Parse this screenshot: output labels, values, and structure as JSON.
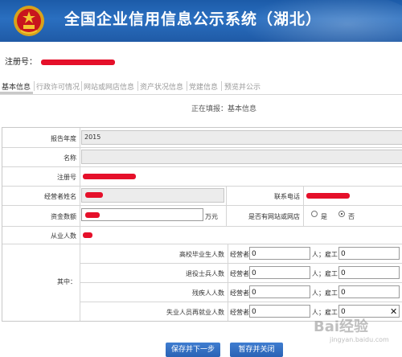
{
  "header": {
    "title": "全国企业信用信息公示系统（湖北）"
  },
  "reg": {
    "label": "注册号："
  },
  "tabs": [
    {
      "label": "基本信息",
      "active": true
    },
    {
      "label": "行政许可情况",
      "active": false
    },
    {
      "label": "网站或网店信息",
      "active": false
    },
    {
      "label": "资产状况信息",
      "active": false
    },
    {
      "label": "党建信息",
      "active": false
    },
    {
      "label": "预览并公示",
      "active": false
    }
  ],
  "status": {
    "filling": "正在填报：基本信息"
  },
  "form": {
    "report_year_label": "报告年度",
    "report_year_value": "2015",
    "name_label": "名称",
    "reg_no_label": "注册号",
    "operator_label": "经营者姓名",
    "phone_label": "联系电话",
    "capital_label": "资金数额",
    "capital_unit": "万元",
    "website_label": "是否有网站或网店",
    "website_options": [
      "是",
      "否"
    ],
    "website_selected": "否",
    "employees_label": "从业人数",
    "among_label": "其中：",
    "sub_rows": [
      {
        "label": "高校毕业生人数",
        "operator_label": "经营者",
        "operator_value": "0",
        "employee_label": "人；雇工",
        "employee_value": "0"
      },
      {
        "label": "退役士兵人数",
        "operator_label": "经营者",
        "operator_value": "0",
        "employee_label": "人；雇工",
        "employee_value": "0"
      },
      {
        "label": "残疾人人数",
        "operator_label": "经营者",
        "operator_value": "0",
        "employee_label": "人；雇工",
        "employee_value": "0"
      },
      {
        "label": "失业人员再就业人数",
        "operator_label": "经营者",
        "operator_value": "0",
        "employee_label": "人；雇工",
        "employee_value": "0"
      }
    ]
  },
  "buttons": {
    "save_next": "保存并下一步",
    "save_close": "暂存并关闭"
  },
  "watermark": {
    "text": "Bai经验",
    "sub": "jingyan.baidu.com"
  },
  "colors": {
    "banner": "#1f5aa6",
    "redaction": "#e5102a",
    "button": "#2a63b5"
  }
}
